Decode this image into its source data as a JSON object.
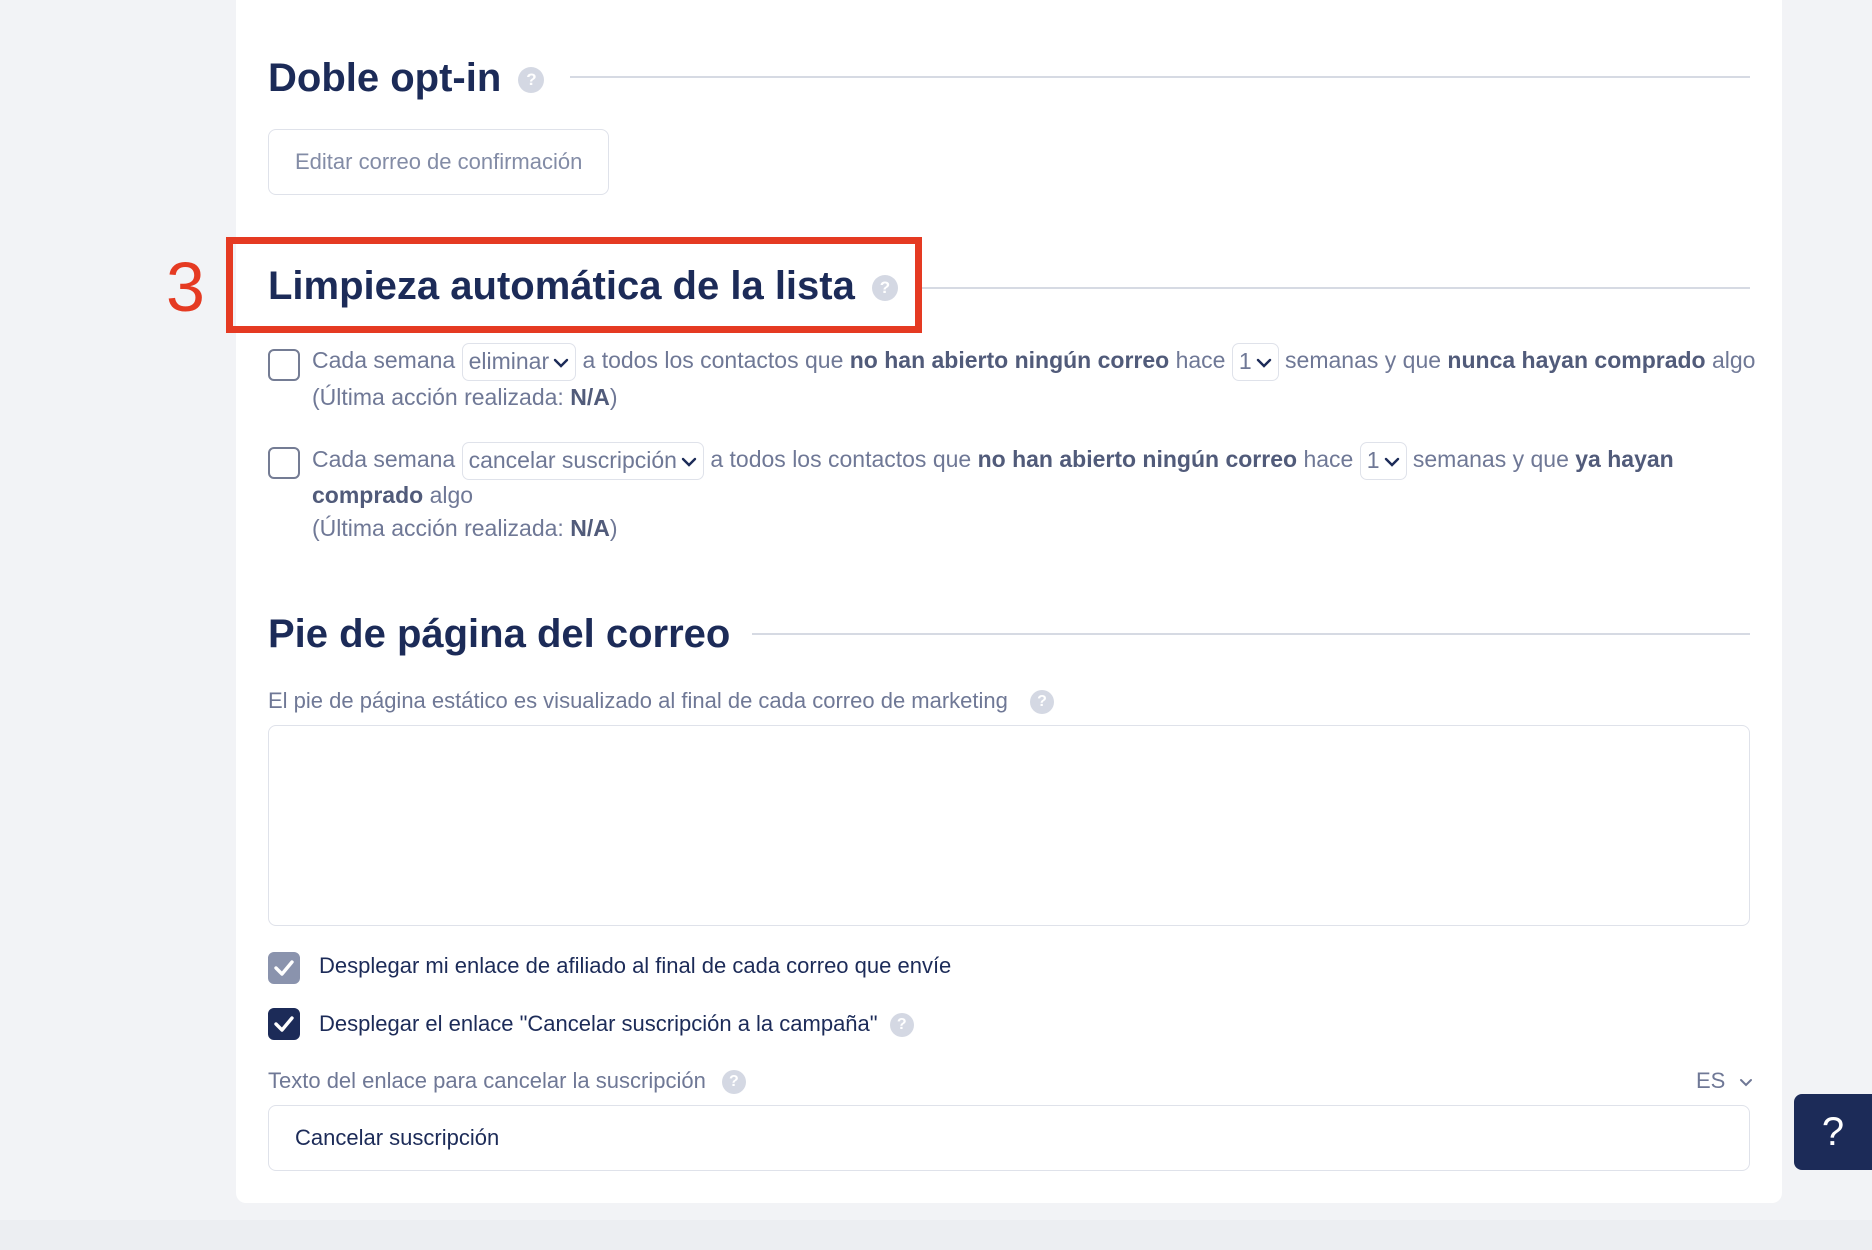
{
  "double_opt_in": {
    "title": "Doble opt-in",
    "edit_button": "Editar correo de confirmación"
  },
  "list_cleaning": {
    "step_number": "3",
    "title": "Limpieza automática de la lista",
    "rules": [
      {
        "prefix": "Cada semana",
        "action": "eliminar",
        "middle": "a todos los contactos que",
        "condition": "no han abierto ningún correo",
        "hace": "hace",
        "weeks": "1",
        "weeks_suffix": "semanas y que",
        "purchase": "nunca hayan comprado",
        "tail": "algo",
        "last_action_label": "(Última acción realizada:",
        "last_action_value": "N/A",
        "last_action_close": ")"
      },
      {
        "prefix": "Cada semana",
        "action": "cancelar suscripción",
        "middle": "a todos los contactos que",
        "condition": "no han abierto ningún correo",
        "hace": "hace",
        "weeks": "1",
        "weeks_suffix": "semanas y que",
        "purchase_line1": "ya hayan",
        "purchase_line2": "comprado",
        "tail": "algo",
        "last_action_label": "(Última acción realizada:",
        "last_action_value": "N/A",
        "last_action_close": ")"
      }
    ]
  },
  "footer": {
    "title": "Pie de página del correo",
    "description": "El pie de página estático es visualizado al final de cada correo de marketing",
    "affiliate_option": "Desplegar mi enlace de afiliado al final de cada correo que envíe",
    "unsubscribe_option": "Desplegar el enlace \"Cancelar suscripción a la campaña\"",
    "unsubscribe_text_label": "Texto del enlace para cancelar la suscripción",
    "language": "ES",
    "unsubscribe_text_value": "Cancelar suscripción"
  },
  "help_fab": "?",
  "help_icon": "?",
  "colors": {
    "navy": "#1c2b58",
    "highlight": "#e53a22",
    "muted_text": "#6f7896"
  }
}
